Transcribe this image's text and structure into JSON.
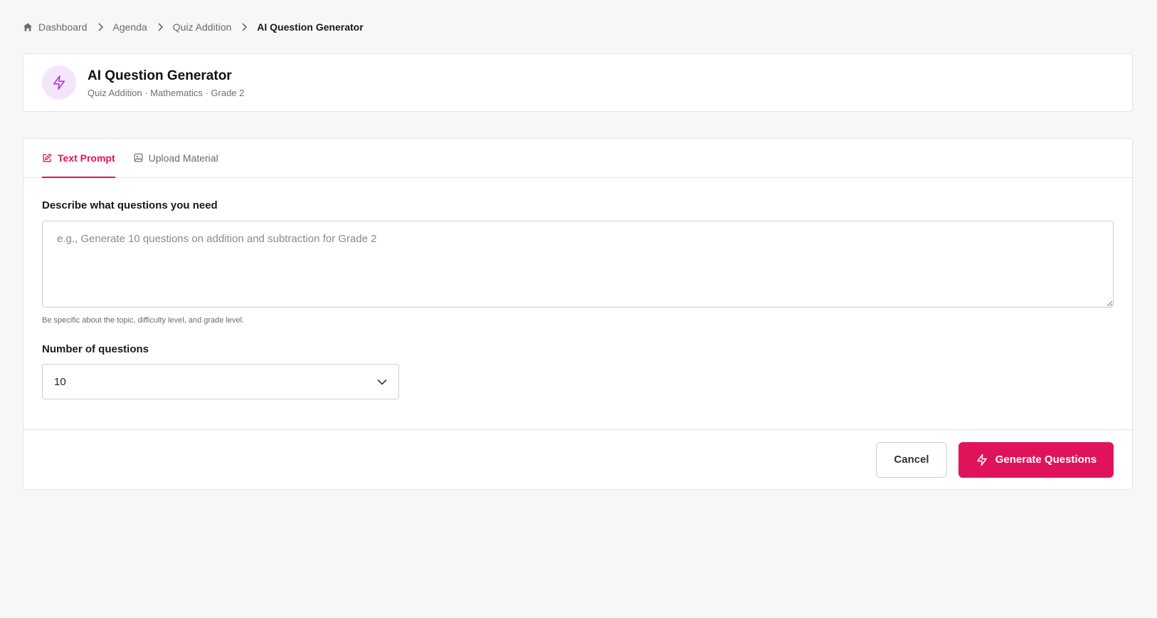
{
  "breadcrumb": {
    "items": [
      "Dashboard",
      "Agenda",
      "Quiz Addition"
    ],
    "current": "AI Question Generator"
  },
  "header": {
    "title": "AI Question Generator",
    "subtitle": "Quiz Addition · Mathematics · Grade 2",
    "icon": "lightning-icon"
  },
  "tabs": [
    {
      "label": "Text Prompt",
      "icon": "edit-icon",
      "active": true
    },
    {
      "label": "Upload Material",
      "icon": "image-icon",
      "active": false
    }
  ],
  "form": {
    "prompt_label": "Describe what questions you need",
    "prompt_placeholder": "e.g., Generate 10 questions on addition and subtraction for Grade 2",
    "prompt_value": "",
    "hint": "Be specific about the topic, difficulty level, and grade level.",
    "count_label": "Number of questions",
    "count_value": "10"
  },
  "footer": {
    "cancel_label": "Cancel",
    "generate_label": "Generate Questions"
  },
  "colors": {
    "accent": "#e0135a",
    "icon_bg": "#f3e6fb",
    "icon_stroke": "#b23ad6"
  }
}
